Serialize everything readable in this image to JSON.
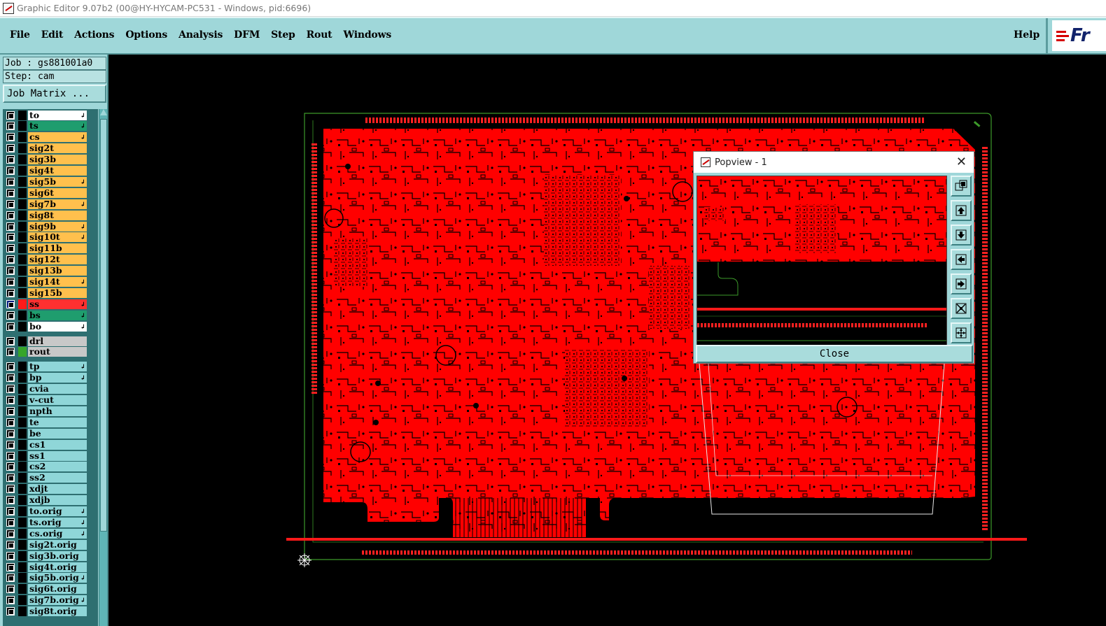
{
  "window": {
    "title": "Graphic Editor 9.07b2 (00@HY-HYCAM-PC531 - Windows, pid:6696)"
  },
  "menu": {
    "items": [
      "File",
      "Edit",
      "Actions",
      "Options",
      "Analysis",
      "DFM",
      "Step",
      "Rout",
      "Windows"
    ],
    "help": "Help",
    "logo_text": "Fr"
  },
  "panel": {
    "job": "Job : gs881001a0",
    "step": "Step: cam",
    "job_matrix": "Job Matrix ..."
  },
  "layers": [
    {
      "name": "to",
      "color": "#ffffff",
      "flag": "↲",
      "group": 1
    },
    {
      "name": "ts",
      "color": "#1f9d6e",
      "flag": "↲",
      "group": 1
    },
    {
      "name": "cs",
      "color": "#ffc04d",
      "flag": "↲",
      "group": 1
    },
    {
      "name": "sig2t",
      "color": "#ffc04d",
      "flag": "",
      "group": 1
    },
    {
      "name": "sig3b",
      "color": "#ffc04d",
      "flag": "",
      "group": 1
    },
    {
      "name": "sig4t",
      "color": "#ffc04d",
      "flag": "",
      "group": 1
    },
    {
      "name": "sig5b",
      "color": "#ffc04d",
      "flag": "↲",
      "group": 1
    },
    {
      "name": "sig6t",
      "color": "#ffc04d",
      "flag": "",
      "group": 1
    },
    {
      "name": "sig7b",
      "color": "#ffc04d",
      "flag": "↲",
      "group": 1
    },
    {
      "name": "sig8t",
      "color": "#ffc04d",
      "flag": "",
      "group": 1
    },
    {
      "name": "sig9b",
      "color": "#ffc04d",
      "flag": "↲",
      "group": 1
    },
    {
      "name": "sig10t",
      "color": "#ffc04d",
      "flag": "↲",
      "group": 1
    },
    {
      "name": "sig11b",
      "color": "#ffc04d",
      "flag": "",
      "group": 1
    },
    {
      "name": "sig12t",
      "color": "#ffc04d",
      "flag": "",
      "group": 1
    },
    {
      "name": "sig13b",
      "color": "#ffc04d",
      "flag": "",
      "group": 1
    },
    {
      "name": "sig14t",
      "color": "#ffc04d",
      "flag": "↲",
      "group": 1
    },
    {
      "name": "sig15b",
      "color": "#ffc04d",
      "flag": "",
      "group": 1
    },
    {
      "name": "ss",
      "color": "#ff3030",
      "flag": "↲",
      "group": 1,
      "selected": true
    },
    {
      "name": "bs",
      "color": "#1f9d6e",
      "flag": "↲",
      "group": 1
    },
    {
      "name": "bo",
      "color": "#ffffff",
      "flag": "↲",
      "group": 1
    },
    {
      "name": "drl",
      "color": "#c8c8c8",
      "flag": "",
      "group": 2
    },
    {
      "name": "rout",
      "color": "#c8c8c8",
      "flag": "",
      "group": 2,
      "swatch": "#36a52a"
    },
    {
      "name": "tp",
      "color": "#8fd6d8",
      "flag": "↲",
      "group": 3
    },
    {
      "name": "bp",
      "color": "#8fd6d8",
      "flag": "↲",
      "group": 3
    },
    {
      "name": "cvia",
      "color": "#8fd6d8",
      "flag": "",
      "group": 3
    },
    {
      "name": "v-cut",
      "color": "#8fd6d8",
      "flag": "",
      "group": 3
    },
    {
      "name": "npth",
      "color": "#8fd6d8",
      "flag": "",
      "group": 3
    },
    {
      "name": "te",
      "color": "#8fd6d8",
      "flag": "",
      "group": 3
    },
    {
      "name": "be",
      "color": "#8fd6d8",
      "flag": "",
      "group": 3
    },
    {
      "name": "cs1",
      "color": "#8fd6d8",
      "flag": "",
      "group": 3
    },
    {
      "name": "ss1",
      "color": "#8fd6d8",
      "flag": "",
      "group": 3
    },
    {
      "name": "cs2",
      "color": "#8fd6d8",
      "flag": "",
      "group": 3
    },
    {
      "name": "ss2",
      "color": "#8fd6d8",
      "flag": "",
      "group": 3
    },
    {
      "name": "xdjt",
      "color": "#8fd6d8",
      "flag": "",
      "group": 3
    },
    {
      "name": "xdjb",
      "color": "#8fd6d8",
      "flag": "",
      "group": 3
    },
    {
      "name": "to.orig",
      "color": "#8fd6d8",
      "flag": "↲",
      "group": 3
    },
    {
      "name": "ts.orig",
      "color": "#8fd6d8",
      "flag": "↲",
      "group": 3
    },
    {
      "name": "cs.orig",
      "color": "#8fd6d8",
      "flag": "↲",
      "group": 3
    },
    {
      "name": "sig2t.orig",
      "color": "#8fd6d8",
      "flag": "",
      "group": 3
    },
    {
      "name": "sig3b.orig",
      "color": "#8fd6d8",
      "flag": "",
      "group": 3
    },
    {
      "name": "sig4t.orig",
      "color": "#8fd6d8",
      "flag": "",
      "group": 3
    },
    {
      "name": "sig5b.orig",
      "color": "#8fd6d8",
      "flag": "↲",
      "group": 3
    },
    {
      "name": "sig6t.orig",
      "color": "#8fd6d8",
      "flag": "",
      "group": 3
    },
    {
      "name": "sig7b.orig",
      "color": "#8fd6d8",
      "flag": "↲",
      "group": 3
    },
    {
      "name": "sig8t.orig",
      "color": "#8fd6d8",
      "flag": "",
      "group": 3
    }
  ],
  "popview": {
    "title": "Popview - 1",
    "close_button": "Close",
    "tools": [
      "zoom-window-icon",
      "pan-up-icon",
      "pan-down-icon",
      "pan-left-icon",
      "pan-right-icon",
      "zoom-fit-icon",
      "zoom-home-icon"
    ]
  },
  "colors": {
    "board": "#ff0000",
    "outline": "#3d9a2a",
    "menubar": "#9fd7d9",
    "canvas": "#000000"
  }
}
